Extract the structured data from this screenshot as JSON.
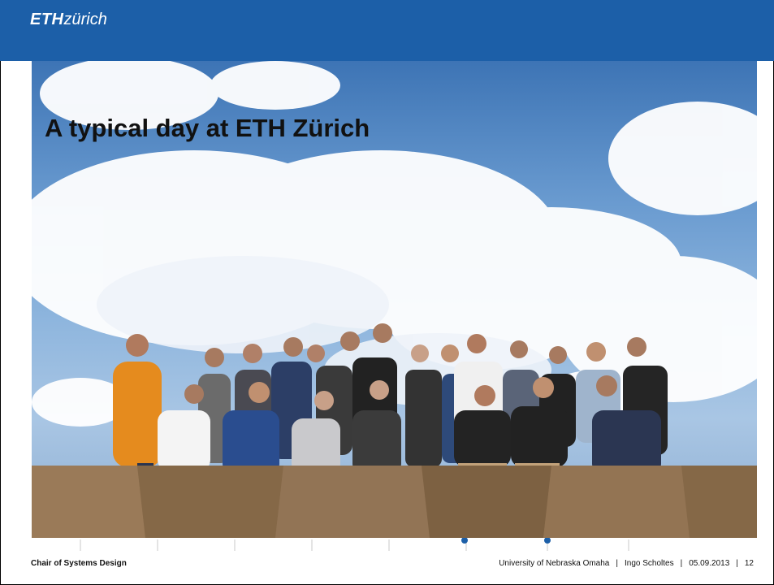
{
  "header": {
    "logo_bold": "ETH",
    "logo_light": "zürich",
    "color": "#1c5fa8"
  },
  "slide": {
    "title": "A typical day at ETH Zürich"
  },
  "footer": {
    "left": "Chair of Systems Design",
    "university": "University of Nebraska Omaha",
    "author": "Ingo Scholtes",
    "date": "05.09.2013",
    "page": "12"
  }
}
